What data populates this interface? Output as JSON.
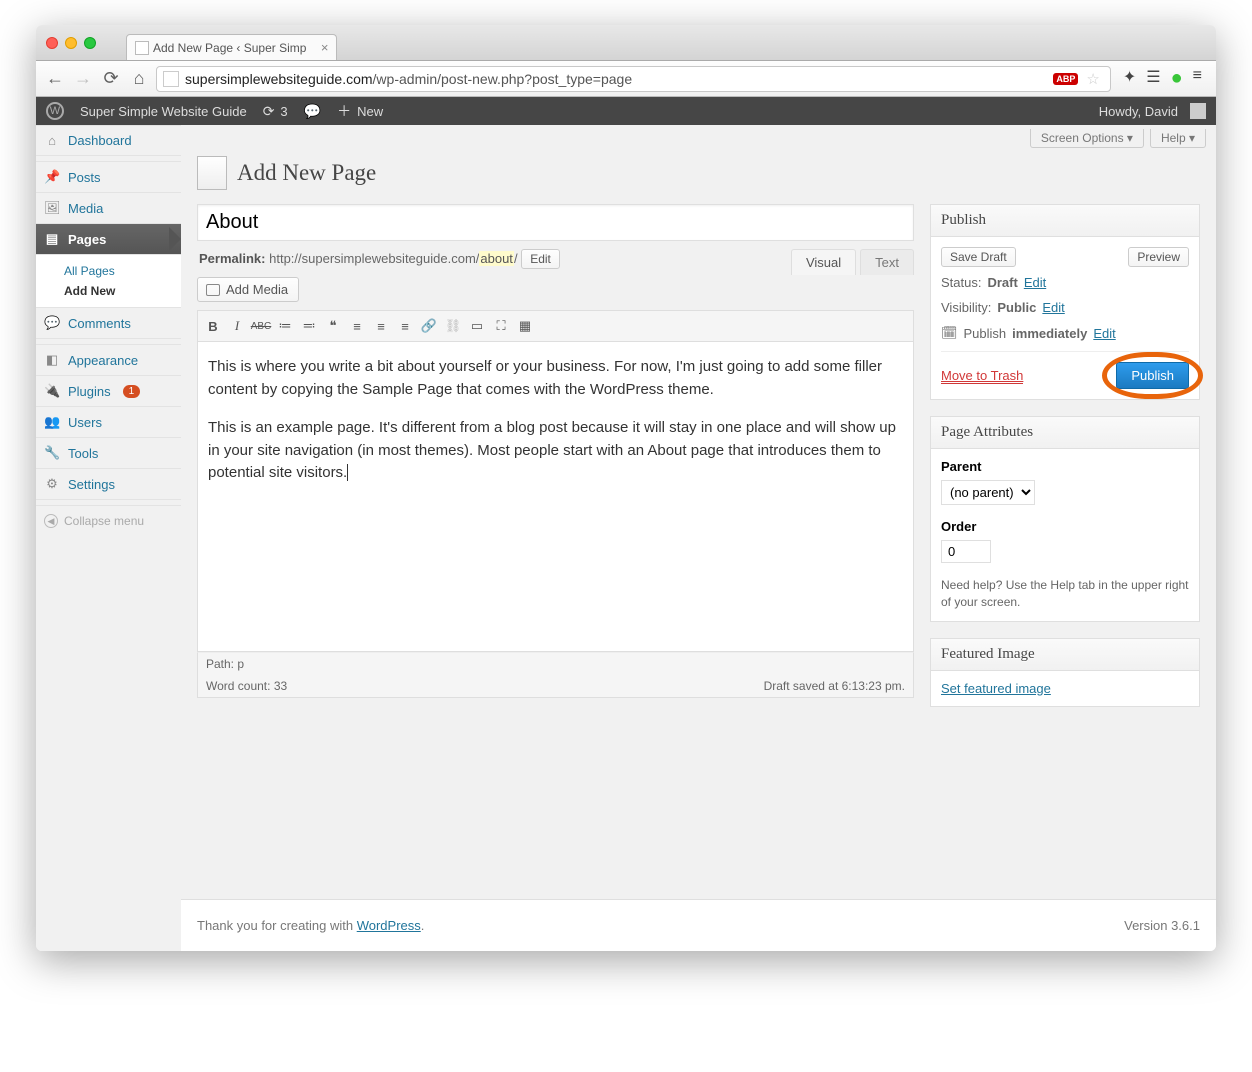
{
  "browser": {
    "tab_title": "Add New Page ‹ Super Simp",
    "url_host": "supersimplewebsiteguide.com",
    "url_path": "/wp-admin/post-new.php?post_type=page"
  },
  "adminbar": {
    "site_name": "Super Simple Website Guide",
    "updates_count": "3",
    "new_label": "New",
    "greeting": "Howdy, David"
  },
  "screen_meta": {
    "options": "Screen Options ▾",
    "help": "Help ▾"
  },
  "heading": "Add New Page",
  "sidebar": {
    "dashboard": "Dashboard",
    "posts": "Posts",
    "media": "Media",
    "pages": "Pages",
    "sub_all": "All Pages",
    "sub_new": "Add New",
    "comments": "Comments",
    "appearance": "Appearance",
    "plugins": "Plugins",
    "plugins_count": "1",
    "users": "Users",
    "tools": "Tools",
    "settings": "Settings",
    "collapse": "Collapse menu"
  },
  "title_value": "About",
  "permalink": {
    "label": "Permalink:",
    "base": "http://supersimplewebsiteguide.com/",
    "slug": "about",
    "tail": "/",
    "edit": "Edit"
  },
  "media_button": "Add Media",
  "editor_tabs": {
    "visual": "Visual",
    "text": "Text"
  },
  "content": {
    "p1": "This is where you write a bit about yourself or your business. For now, I'm just going to add some filler content by copying the Sample Page that comes with the WordPress theme.",
    "p2": "This is an example page. It's different from a blog post because it will stay in one place and will show up in your site navigation (in most themes). Most people start with an About page that introduces them to potential site visitors."
  },
  "statusbar": {
    "path": "Path: p",
    "wordcount_label": "Word count: ",
    "wordcount": "33",
    "autosave": "Draft saved at 6:13:23 pm."
  },
  "publish": {
    "box_title": "Publish",
    "save_draft": "Save Draft",
    "preview": "Preview",
    "status_label": "Status:",
    "status_value": "Draft",
    "visibility_label": "Visibility:",
    "visibility_value": "Public",
    "schedule_label": "Publish",
    "schedule_value": "immediately",
    "edit": "Edit",
    "trash": "Move to Trash",
    "button": "Publish"
  },
  "attributes": {
    "box_title": "Page Attributes",
    "parent_label": "Parent",
    "parent_value": "(no parent)",
    "order_label": "Order",
    "order_value": "0",
    "help": "Need help? Use the Help tab in the upper right of your screen."
  },
  "featured": {
    "box_title": "Featured Image",
    "link": "Set featured image"
  },
  "footer": {
    "thanks": "Thank you for creating with ",
    "wp": "WordPress",
    "period": ".",
    "version": "Version 3.6.1"
  }
}
